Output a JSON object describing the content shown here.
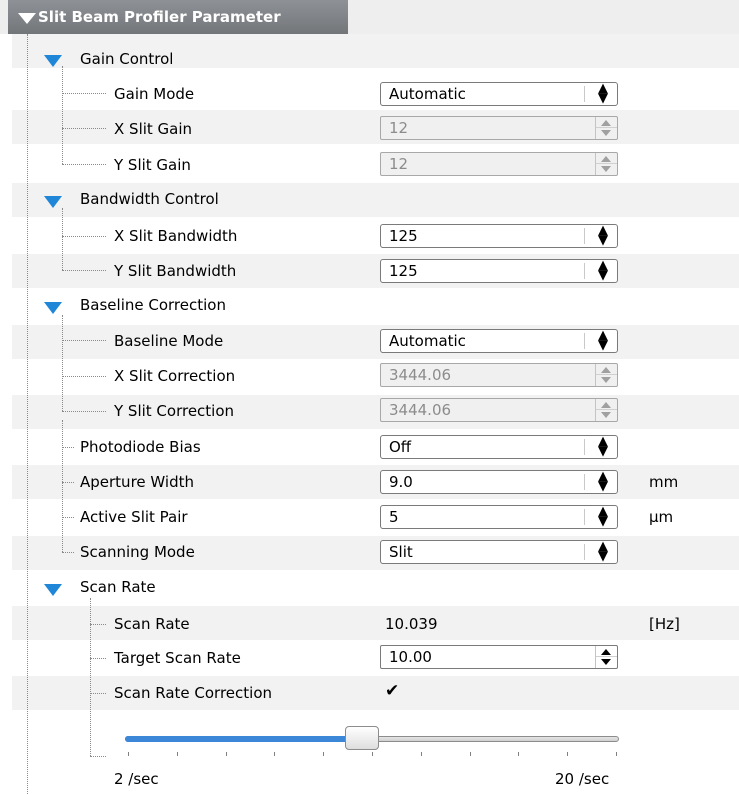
{
  "panel_title": "Slit Beam Profiler Parameter",
  "gain_control": {
    "label": "Gain Control",
    "gain_mode": {
      "label": "Gain Mode",
      "value": "Automatic"
    },
    "x_gain": {
      "label": "X Slit Gain",
      "value": "12"
    },
    "y_gain": {
      "label": "Y Slit Gain",
      "value": "12"
    }
  },
  "bandwidth_control": {
    "label": "Bandwidth Control",
    "x_bandwidth": {
      "label": "X Slit Bandwidth",
      "value": "125"
    },
    "y_bandwidth": {
      "label": "Y Slit Bandwidth",
      "value": "125"
    }
  },
  "baseline_correction": {
    "label": "Baseline Correction",
    "baseline_mode": {
      "label": "Baseline Mode",
      "value": "Automatic"
    },
    "x_correction": {
      "label": "X Slit Correction",
      "value": "3444.06"
    },
    "y_correction": {
      "label": "Y Slit Correction",
      "value": "3444.06"
    }
  },
  "photodiode_bias": {
    "label": "Photodiode Bias",
    "value": "Off"
  },
  "aperture_width": {
    "label": "Aperture Width",
    "value": "9.0",
    "unit": "mm"
  },
  "active_slit_pair": {
    "label": "Active Slit Pair",
    "value": "5",
    "unit": "µm"
  },
  "scanning_mode": {
    "label": "Scanning Mode",
    "value": "Slit"
  },
  "scan_rate": {
    "label": "Scan Rate",
    "current": {
      "label": "Scan Rate",
      "value": "10.039",
      "unit": "[Hz]"
    },
    "target": {
      "label": "Target Scan Rate",
      "value": "10.00"
    },
    "correction": {
      "label": "Scan Rate Correction",
      "checked": true
    },
    "slider": {
      "min_label": "2 /sec",
      "max_label": "20 /sec",
      "fraction": 0.48
    }
  },
  "icons": {
    "expanded": "triangle-down-icon",
    "checkmark": "check-icon"
  },
  "colors": {
    "accent": "#1f86d8",
    "header": "#808386",
    "row_alt": "#f2f2f2"
  }
}
